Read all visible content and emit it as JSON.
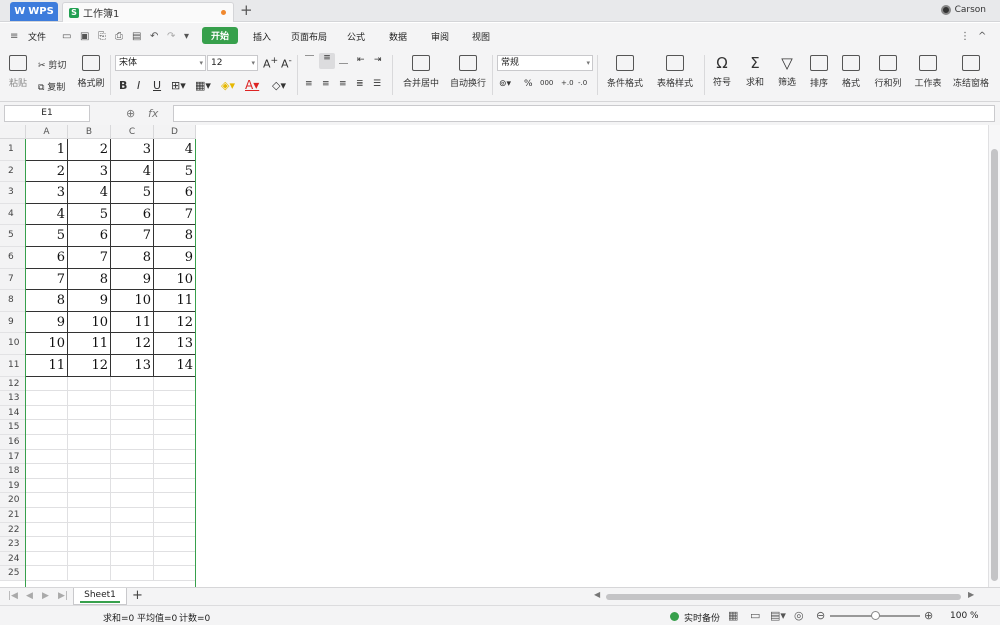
{
  "titlebar": {
    "app": "WPS",
    "document": "工作簿1",
    "user": "Carson"
  },
  "menu": {
    "file": "文件",
    "items": [
      "开始",
      "插入",
      "页面布局",
      "公式",
      "数据",
      "审阅",
      "视图"
    ]
  },
  "ribbon": {
    "paste": "粘贴",
    "cut": "剪切",
    "copy": "复制",
    "format_painter": "格式刷",
    "font": "宋体",
    "font_size": "12",
    "bold": "B",
    "italic": "I",
    "underline": "U",
    "merge": "合并居中",
    "wrap": "自动换行",
    "number_format": "常规",
    "percent": "%",
    "thousands": "000",
    "cond_format": "条件格式",
    "table_style": "表格样式",
    "symbol": "符号",
    "sum": "求和",
    "filter": "筛选",
    "sort": "排序",
    "format": "格式",
    "row_col": "行和列",
    "worksheet": "工作表",
    "freeze": "冻结窗格"
  },
  "formula_bar": {
    "cell_ref": "E1",
    "fx": "fx",
    "formula": ""
  },
  "grid": {
    "columns": [
      "A",
      "B",
      "C",
      "D"
    ],
    "rows": [
      "1",
      "2",
      "3",
      "4",
      "5",
      "6",
      "7",
      "8",
      "9",
      "10",
      "11",
      "12",
      "13",
      "14",
      "15",
      "16",
      "17",
      "18",
      "19",
      "20",
      "21",
      "22",
      "23",
      "24",
      "25"
    ],
    "cells": [
      [
        "1",
        "2",
        "3",
        "4"
      ],
      [
        "2",
        "3",
        "4",
        "5"
      ],
      [
        "3",
        "4",
        "5",
        "6"
      ],
      [
        "4",
        "5",
        "6",
        "7"
      ],
      [
        "5",
        "6",
        "7",
        "8"
      ],
      [
        "6",
        "7",
        "8",
        "9"
      ],
      [
        "7",
        "8",
        "9",
        "10"
      ],
      [
        "8",
        "9",
        "10",
        "11"
      ],
      [
        "9",
        "10",
        "11",
        "12"
      ],
      [
        "10",
        "11",
        "12",
        "13"
      ],
      [
        "11",
        "12",
        "13",
        "14"
      ]
    ]
  },
  "sheets": {
    "active": "Sheet1",
    "add": "+"
  },
  "status": {
    "sum": "求和=0",
    "avg": "平均值=0",
    "count": "计数=0",
    "backup": "实时备份",
    "zoom": "100 %"
  },
  "colors": {
    "accent": "#37a04c",
    "wps_blue": "#3d7cdc",
    "dot": "#f0882e"
  }
}
